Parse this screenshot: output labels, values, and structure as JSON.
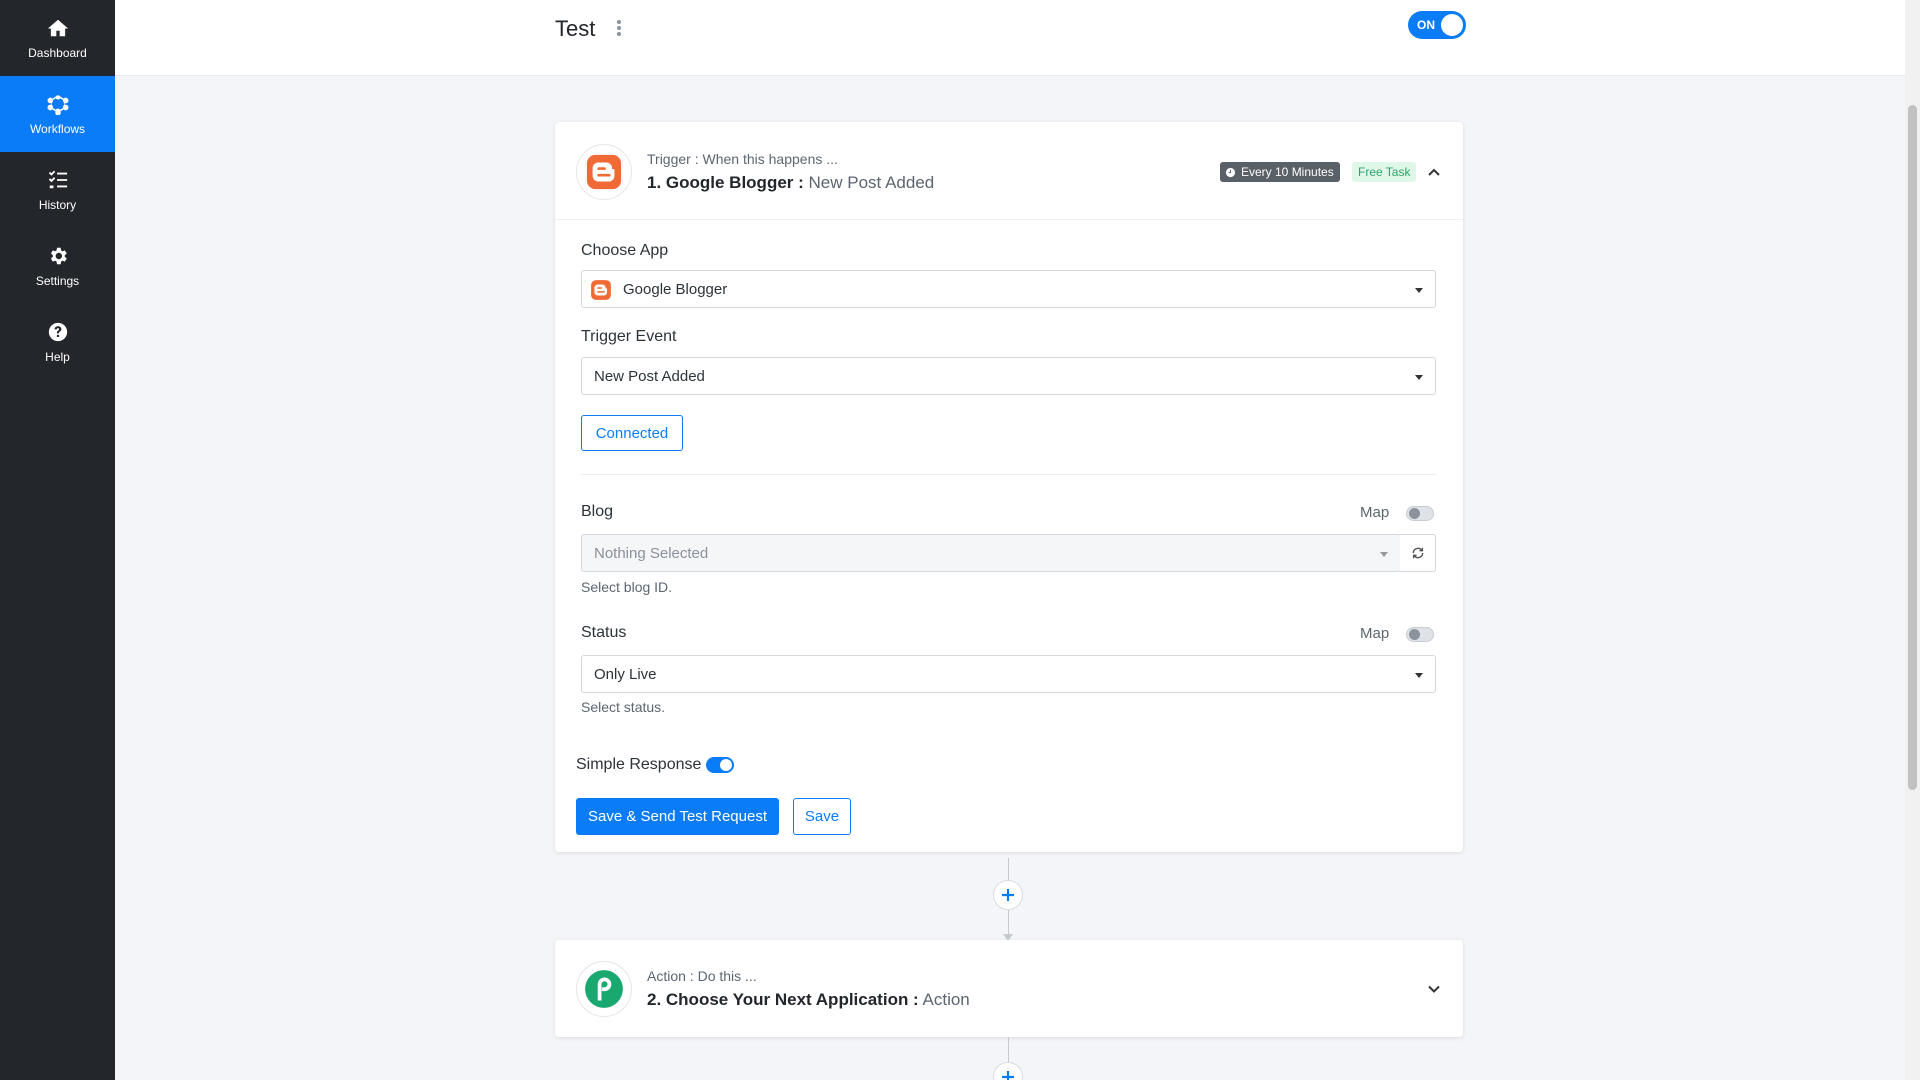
{
  "sidebar": {
    "items": [
      {
        "label": "Dashboard",
        "icon": "home-icon",
        "active": false
      },
      {
        "label": "Workflows",
        "icon": "workflow-icon",
        "active": true
      },
      {
        "label": "History",
        "icon": "list-check-icon",
        "active": false
      },
      {
        "label": "Settings",
        "icon": "gear-icon",
        "active": false
      },
      {
        "label": "Help",
        "icon": "help-circle-icon",
        "active": false
      }
    ]
  },
  "header": {
    "title": "Test",
    "toggle_label": "ON"
  },
  "trigger": {
    "subtitle": "Trigger : When this happens ...",
    "step_name": "1. Google Blogger :",
    "event": "New Post Added",
    "interval_badge": "Every 10 Minutes",
    "task_badge": "Free Task",
    "choose_app_label": "Choose App",
    "choose_app_value": "Google Blogger",
    "trigger_event_label": "Trigger Event",
    "trigger_event_value": "New Post Added",
    "connected_label": "Connected",
    "blog_label": "Blog",
    "map_label": "Map",
    "blog_value": "Nothing Selected",
    "blog_hint": "Select blog ID.",
    "status_label": "Status",
    "status_value": "Only Live",
    "status_hint": "Select status.",
    "simple_response_label": "Simple Response",
    "save_test_label": "Save & Send Test Request",
    "save_label": "Save"
  },
  "action": {
    "subtitle": "Action : Do this ...",
    "step_name": "2. Choose Your Next Application :",
    "event": "Action"
  },
  "colors": {
    "accent": "#0b7cf8",
    "sidebar_bg": "#23262b",
    "blogger_orange": "#f06a35",
    "pabbly_green": "#1aa871",
    "free_badge_bg": "#dff7e9"
  }
}
